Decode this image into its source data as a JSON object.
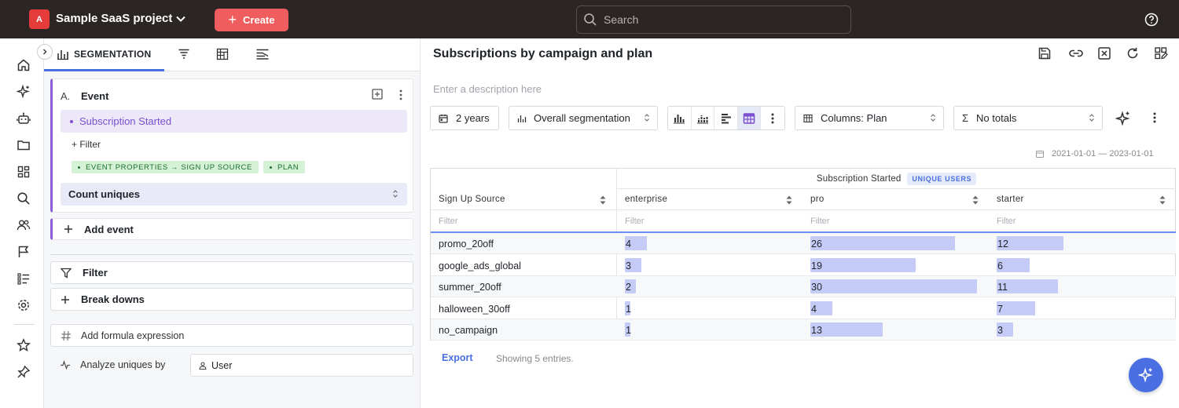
{
  "topbar": {
    "project_initial": "A",
    "project_name": "Sample SaaS project",
    "create_label": "Create",
    "search_placeholder": "Search"
  },
  "leftnav": {
    "icons": [
      "home-icon",
      "sparkle-icon",
      "robot-icon",
      "folder-icon",
      "dashboard-icon",
      "search-icon",
      "users-icon",
      "flag-icon",
      "list-icon",
      "gear-icon",
      "star-icon",
      "pin-icon"
    ]
  },
  "query": {
    "tab_label": "SEGMENTATION",
    "event": {
      "letter": "A.",
      "title": "Event",
      "selected": "Subscription Started",
      "filter_label": "+ Filter",
      "chips": [
        "EVENT PROPERTIES → SIGN UP SOURCE",
        "PLAN"
      ],
      "measure": "Count uniques"
    },
    "add_event": "Add event",
    "filter": "Filter",
    "breakdowns": "Break downs",
    "formula": "Add formula expression",
    "analyze_label": "Analyze uniques by",
    "analyze_value": "User"
  },
  "main": {
    "title": "Subscriptions by campaign and plan",
    "description_placeholder": "Enter a description here",
    "controls": {
      "range": "2 years",
      "segmentation": "Overall segmentation",
      "columns": "Columns: Plan",
      "totals": "No totals"
    },
    "date_range": "2021-01-01 — 2023-01-01",
    "table": {
      "group_header": "Subscription Started",
      "badge": "UNIQUE USERS",
      "row_header": "Sign Up Source",
      "columns": [
        "enterprise",
        "pro",
        "starter"
      ],
      "filter_placeholder": "Filter",
      "rows": [
        {
          "label": "promo_20off",
          "values": [
            4,
            26,
            12
          ]
        },
        {
          "label": "google_ads_global",
          "values": [
            3,
            19,
            6
          ]
        },
        {
          "label": "summer_20off",
          "values": [
            2,
            30,
            11
          ]
        },
        {
          "label": "halloween_30off",
          "values": [
            1,
            4,
            7
          ]
        },
        {
          "label": "no_campaign",
          "values": [
            1,
            13,
            3
          ]
        }
      ]
    },
    "export": "Export",
    "showing": "Showing 5 entries."
  },
  "colors": {
    "accent": "#4a6fe3",
    "create": "#f05d5e",
    "event_purple": "#8a5cd6",
    "bar": "#c4cbf7"
  }
}
